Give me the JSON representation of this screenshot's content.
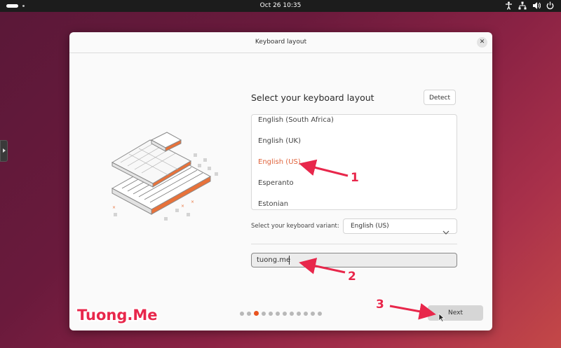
{
  "topbar": {
    "clock": "Oct 26  10:35",
    "icons": [
      "accessibility-icon",
      "network-icon",
      "volume-icon",
      "power-icon"
    ]
  },
  "dialog": {
    "title": "Keyboard layout",
    "heading": "Select your keyboard layout",
    "detect_label": "Detect",
    "layouts": [
      "English (South Africa)",
      "English (UK)",
      "English (US)",
      "Esperanto",
      "Estonian"
    ],
    "selected_layout": "English (US)",
    "variant_label": "Select your keyboard variant:",
    "variant_value": "English (US)",
    "test_input_value": "tuong.me",
    "pager": {
      "total": 12,
      "current": 3
    },
    "next_label": "Next"
  },
  "annotations": [
    "1",
    "2",
    "3"
  ],
  "watermark": "Tuong.Me",
  "colors": {
    "accent": "#e95420",
    "selected_text": "#e0643c",
    "annotation": "#e8274b"
  }
}
